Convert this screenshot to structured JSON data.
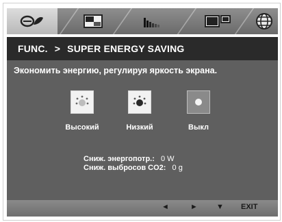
{
  "tabs": [
    {
      "icon": "picture-icon",
      "active": true
    },
    {
      "icon": "pip-layout-icon",
      "active": false
    },
    {
      "icon": "color-bars-icon",
      "active": false
    },
    {
      "icon": "dual-screen-icon",
      "active": false
    },
    {
      "icon": "globe-icon",
      "active": false
    }
  ],
  "header": {
    "func": "FUNC.",
    "separator": ">",
    "title": "SUPER ENERGY SAVING"
  },
  "description": "Экономить энергию, регулируя яркость экрана.",
  "options": [
    {
      "label": "Высокий",
      "icon": "high-saving-icon",
      "selected": false
    },
    {
      "label": "Низкий",
      "icon": "low-saving-icon",
      "selected": false
    },
    {
      "label": "Выкл",
      "icon": "off-icon",
      "selected": true
    }
  ],
  "stats": {
    "power_label": "Сниж. энергопотр.:",
    "power_value": "0 W",
    "co2_label": "Сниж. выбросов CO2:",
    "co2_value": "0 g"
  },
  "navigation": {
    "left": "◄",
    "right": "►",
    "down": "▼",
    "exit": "EXIT"
  },
  "colors": {
    "header_bg": "#2a2a2a",
    "content_bg": "#5f5f5f",
    "selected_bg": "#8a8a8a"
  }
}
